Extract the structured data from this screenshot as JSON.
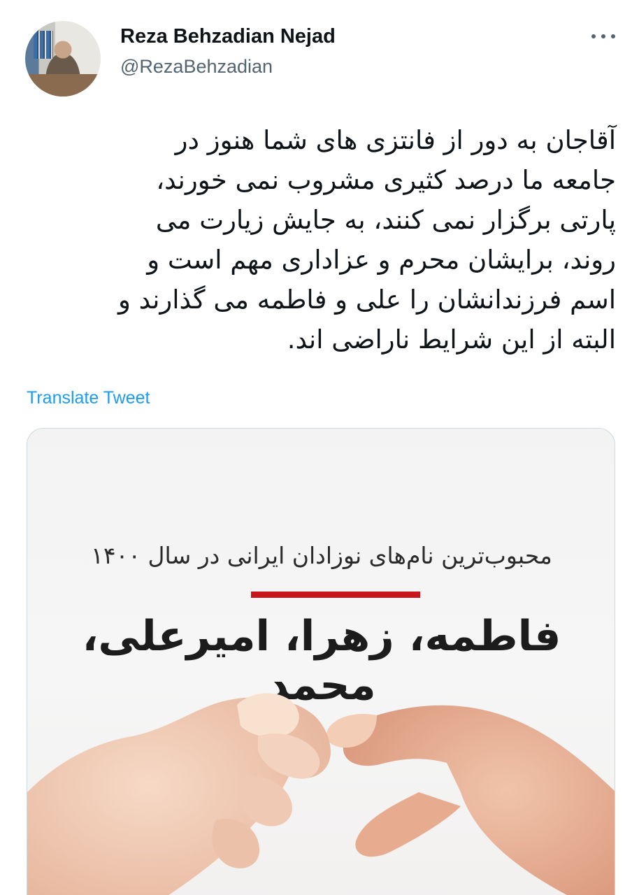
{
  "author": {
    "display_name": "Reza Behzadian Nejad",
    "handle": "@RezaBehzadian"
  },
  "tweet": {
    "text_lines": [
      "آقاجان به دور از فانتزی های شما هنوز در",
      "جامعه ما درصد کثیری مشروب نمی خورند،",
      "پارتی برگزار نمی کنند، به جایش زیارت می",
      "روند، برایشان محرم و عزاداری مهم است و",
      "اسم فرزندانشان را علی و فاطمه می گذارند و",
      "البته از این شرایط ناراضی اند."
    ],
    "translate_label": "Translate Tweet"
  },
  "media": {
    "caption": "محبوب‌ترین نام‌های نوزادان ایرانی در سال ۱۴۰۰",
    "names": "فاطمه، زهرا، امیرعلی، محمد",
    "accent_color": "#c8141b"
  },
  "icons": {
    "more": "more-horizontal-icon"
  }
}
